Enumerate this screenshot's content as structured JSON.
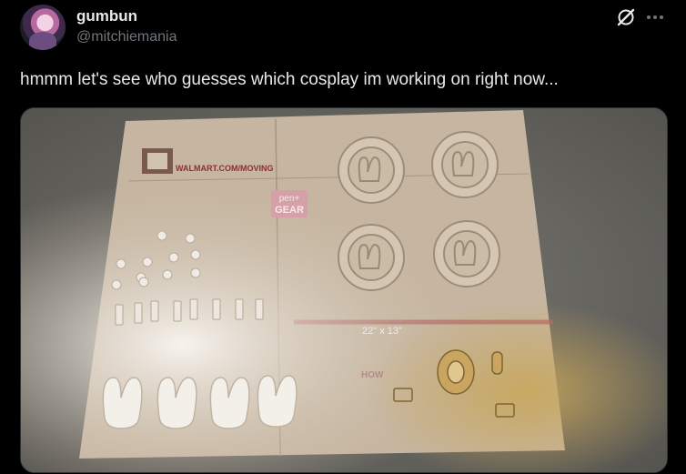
{
  "post": {
    "author_name": "gumbun",
    "author_handle": "@mitchiemania",
    "text": "hmmm let's see who guesses which cosplay im working on right now..."
  },
  "icons": {
    "grok": "grok-icon",
    "more": "more-icon"
  },
  "media": {
    "box_website": "WALMART.COM/MOVING",
    "box_brand_line1": "pen+",
    "box_brand_line2": "GEAR",
    "box_size": "22\" x 13\"",
    "box_how": "HOW"
  },
  "colors": {
    "background": "#000000",
    "primary_text": "#e7e9ea",
    "secondary_text": "#71767b"
  }
}
